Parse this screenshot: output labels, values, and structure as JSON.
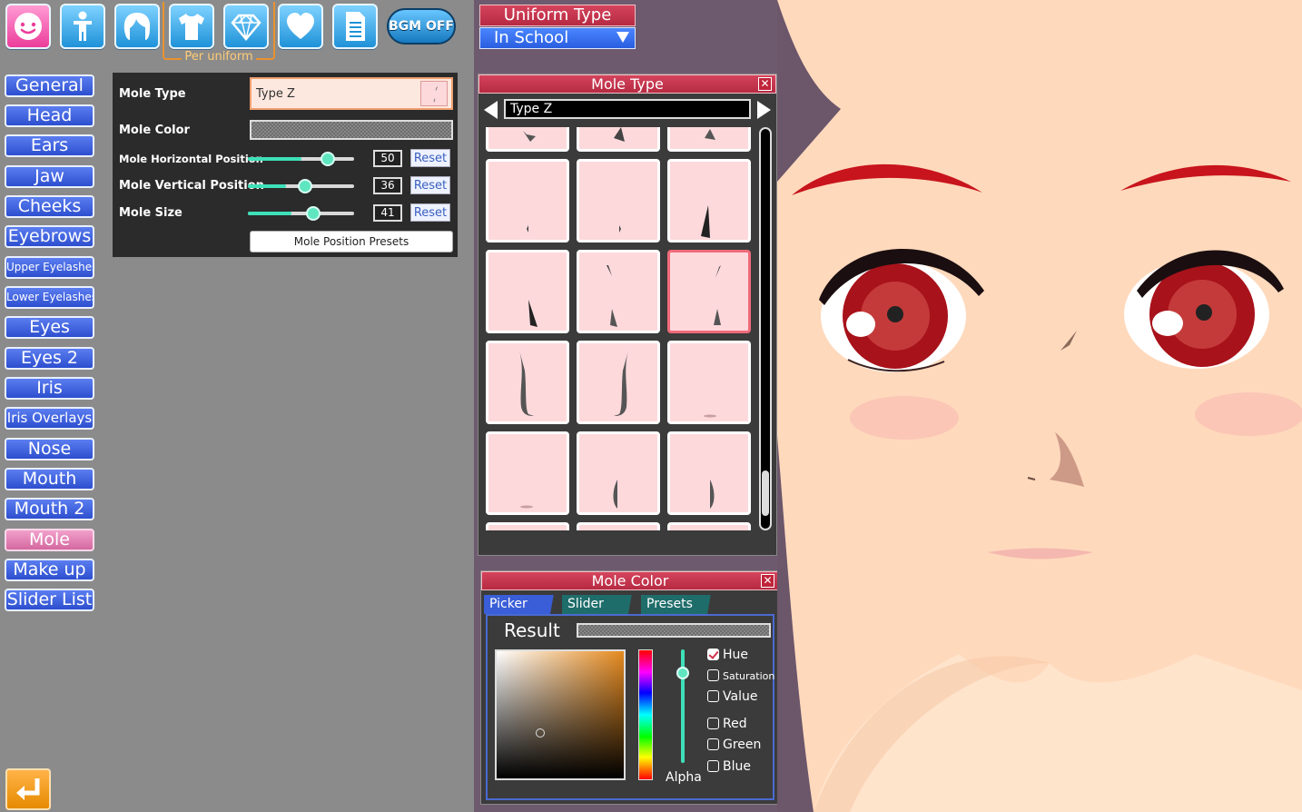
{
  "top_bar": {
    "icons": [
      "face-icon",
      "body-icon",
      "hair-icon",
      "clothes-icon",
      "accessory-icon",
      "personality-icon",
      "profile-icon"
    ],
    "per_uniform_label": "Per uniform",
    "bgm_label": "BGM OFF"
  },
  "categories": [
    {
      "label": "General"
    },
    {
      "label": "Head"
    },
    {
      "label": "Ears"
    },
    {
      "label": "Jaw"
    },
    {
      "label": "Cheeks"
    },
    {
      "label": "Eyebrows"
    },
    {
      "label": "Upper Eyelashes"
    },
    {
      "label": "Lower Eyelashes"
    },
    {
      "label": "Eyes"
    },
    {
      "label": "Eyes 2"
    },
    {
      "label": "Iris"
    },
    {
      "label": "Iris Overlays"
    },
    {
      "label": "Nose"
    },
    {
      "label": "Mouth"
    },
    {
      "label": "Mouth 2"
    },
    {
      "label": "Mole",
      "active": true
    },
    {
      "label": "Make up"
    },
    {
      "label": "Slider List"
    }
  ],
  "settings": {
    "mole_type_label": "Mole Type",
    "mole_type_value": "Type Z",
    "mole_color_label": "Mole Color",
    "sliders": [
      {
        "label": "Mole Horizontal Position",
        "value": "50",
        "level": 0.5
      },
      {
        "label": "Mole Vertical Position",
        "value": "36",
        "level": 0.36
      },
      {
        "label": "Mole Size",
        "value": "41",
        "level": 0.41
      }
    ],
    "reset_label": "Reset",
    "presets_label": "Mole Position Presets"
  },
  "uniform": {
    "title": "Uniform Type",
    "selected": "In School"
  },
  "mole_type_window": {
    "title": "Mole Type",
    "current": "Type Z",
    "close": "✕",
    "selected_tile": 5
  },
  "mole_color_window": {
    "title": "Mole Color",
    "close": "✕",
    "tabs": [
      "Picker",
      "Slider",
      "Presets"
    ],
    "result_label": "Result",
    "alpha_label": "Alpha",
    "options": [
      {
        "label": "Hue",
        "checked": true
      },
      {
        "label": "Saturation",
        "checked": false
      },
      {
        "label": "Value",
        "checked": false
      },
      {
        "label": "Red",
        "checked": false
      },
      {
        "label": "Green",
        "checked": false
      },
      {
        "label": "Blue",
        "checked": false
      }
    ]
  },
  "colors": {
    "category_blue": "#3a5ee0",
    "category_active": "#e07ab0",
    "window_title_red": "#c8344c",
    "slider_teal": "#3ee0b8",
    "mole_tile_pink": "#fdd9dc",
    "iris_red": "#b8141c"
  }
}
